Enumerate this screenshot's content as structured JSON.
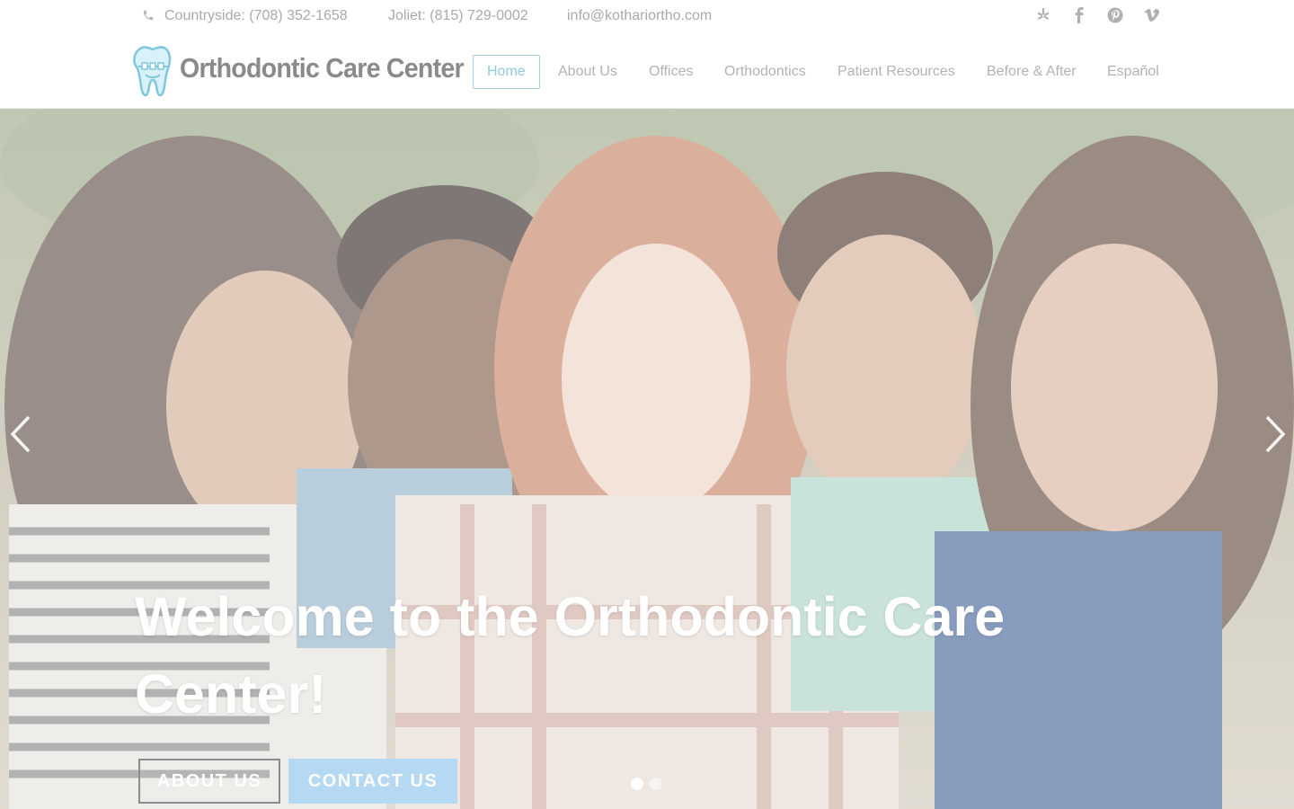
{
  "topbar": {
    "countryside": "Countryside: (708) 352-1658",
    "joliet": "Joliet: (815) 729-0002",
    "email": "info@kothariortho.com",
    "social_icons": [
      "yelp-icon",
      "facebook-icon",
      "pinterest-icon",
      "vimeo-icon"
    ]
  },
  "logo": {
    "text": "Orthodontic Care Center"
  },
  "nav": {
    "items": [
      {
        "label": "Home",
        "active": true
      },
      {
        "label": "About Us"
      },
      {
        "label": "Offices"
      },
      {
        "label": "Orthodontics"
      },
      {
        "label": "Patient Resources"
      },
      {
        "label": "Before & After"
      },
      {
        "label": "Español"
      }
    ]
  },
  "hero": {
    "title": "Welcome to the Orthodontic Care Center!",
    "buttons": {
      "about": "ABOUT US",
      "contact": "CONTACT US"
    },
    "slides": {
      "count": 2,
      "active": 1
    }
  },
  "colors": {
    "accent": "#8fcadb",
    "nav_text": "#b3b3b3",
    "contact_button": "#b5d8f3",
    "hero_title": "#ffffff"
  }
}
